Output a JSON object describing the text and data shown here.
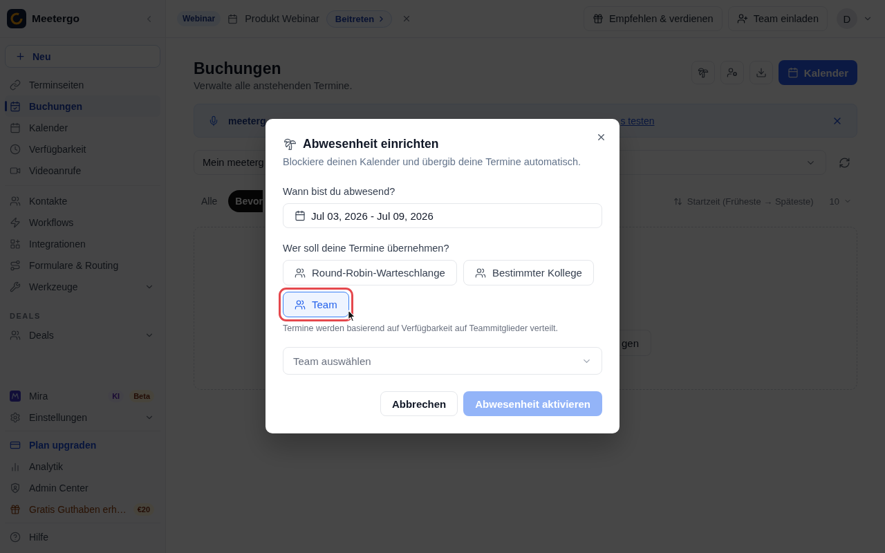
{
  "sidebar": {
    "brand": "Meetergo",
    "new_button": "Neu",
    "sections": [
      {
        "items": [
          {
            "label": "Terminseiten",
            "kind": "link",
            "selected": false
          },
          {
            "label": "Buchungen",
            "kind": "link",
            "selected": true
          },
          {
            "label": "Kalender",
            "kind": "link",
            "selected": false
          },
          {
            "label": "Verfügbarkeit",
            "kind": "link",
            "selected": false
          },
          {
            "label": "Videoanrufe",
            "kind": "link",
            "selected": false
          }
        ]
      },
      {
        "items": [
          {
            "label": "Kontakte",
            "kind": "link",
            "selected": false
          },
          {
            "label": "Workflows",
            "kind": "link",
            "selected": false
          },
          {
            "label": "Integrationen",
            "kind": "link",
            "selected": false
          },
          {
            "label": "Formulare & Routing",
            "kind": "link",
            "selected": false
          },
          {
            "label": "Werkzeuge",
            "kind": "group",
            "selected": false,
            "expanded": false
          }
        ]
      },
      {
        "heading": "DEALS",
        "items": [
          {
            "label": "Deals",
            "kind": "group",
            "selected": false,
            "expanded": false
          }
        ]
      }
    ],
    "footer_sections": [
      {
        "items": [
          {
            "label": "Mira",
            "kind": "link",
            "selected": false,
            "badges": [
              {
                "text": "KI",
                "kind": "ai"
              },
              {
                "text": "Beta",
                "kind": "beta"
              }
            ]
          },
          {
            "label": "Einstellungen",
            "kind": "group",
            "selected": false,
            "expanded": false
          }
        ]
      },
      {
        "items": [
          {
            "label": "Plan upgraden",
            "kind": "upgrade",
            "selected": false
          },
          {
            "label": "Analytik",
            "kind": "link",
            "selected": false
          },
          {
            "label": "Admin Center",
            "kind": "link",
            "selected": false
          },
          {
            "label": "Gratis Guthaben erh…",
            "kind": "reward",
            "selected": false,
            "badges": [
              {
                "text": "€20",
                "kind": "credit"
              }
            ]
          }
        ]
      },
      {
        "items": [
          {
            "label": "Hilfe",
            "kind": "link",
            "selected": false
          }
        ]
      }
    ]
  },
  "topbar": {
    "event": {
      "type_badge": "Webinar",
      "title": "Produkt Webinar",
      "join_button": "Beitreten"
    },
    "actions": [
      "Empfehlen & verdienen",
      "Team einladen"
    ],
    "avatar_initial": "D"
  },
  "page": {
    "title": "Buchungen",
    "subtitle": "Verwalte alle anstehenden Termine.",
    "primary_button": "Kalender",
    "banner": {
      "text": "meeterg",
      "link": "s testen"
    },
    "filter_select": {
      "value": "Mein meeterg"
    },
    "tabs": [
      {
        "label": "Alle",
        "selected": false
      },
      {
        "label": "Bevor",
        "selected": true
      }
    ],
    "sort": "Startzeit (Früheste → Späteste)",
    "page_size": "10",
    "empty_state": {
      "button": "gen"
    }
  },
  "dialog": {
    "title": "Abwesenheit einrichten",
    "subtitle": "Blockiere deinen Kalender und übergib deine Termine automatisch.",
    "date_label": "Wann bist du abwesend?",
    "date_value": "Jul 03, 2026 - Jul 09, 2026",
    "assign_label": "Wer soll deine Termine übernehmen?",
    "options": [
      {
        "label": "Round-Robin-Warteschlange",
        "selected": false,
        "highlighted": false
      },
      {
        "label": "Bestimmter Kollege",
        "selected": false,
        "highlighted": false
      },
      {
        "label": "Team",
        "selected": true,
        "highlighted": true
      }
    ],
    "hint": "Termine werden basierend auf Verfügbarkeit auf Teammitglieder verteilt.",
    "team_select": {
      "placeholder": "Team auswählen"
    },
    "buttons": [
      {
        "label": "Abbrechen",
        "kind": "secondary",
        "disabled": false
      },
      {
        "label": "Abwesenheit aktivieren",
        "kind": "primary",
        "disabled": true
      }
    ]
  }
}
